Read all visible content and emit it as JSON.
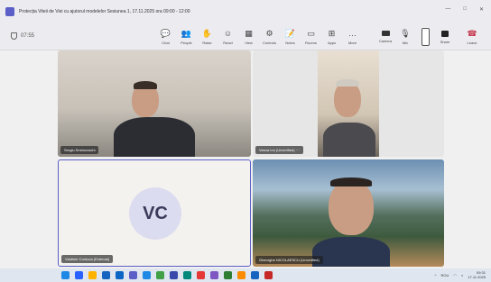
{
  "window": {
    "title": "Protecția Viteii de Viei cu ajutorul modelelor Sesiunea 1, 17.11.2025 ora 09:00 - 12:00",
    "controls": [
      "—",
      "□",
      "✕"
    ]
  },
  "meeting": {
    "timer": "07:55"
  },
  "toolbar": {
    "items": [
      {
        "label": "Chat",
        "icon": "chat-icon",
        "glyph": "💬"
      },
      {
        "label": "People",
        "icon": "people-icon",
        "glyph": "👥"
      },
      {
        "label": "Raise",
        "icon": "raise-hand-icon",
        "glyph": "✋"
      },
      {
        "label": "React",
        "icon": "react-icon",
        "glyph": "☺"
      },
      {
        "label": "View",
        "icon": "view-icon",
        "glyph": "▦"
      },
      {
        "label": "Controls",
        "icon": "controls-icon",
        "glyph": "⚙"
      },
      {
        "label": "Notes",
        "icon": "notes-icon",
        "glyph": "📝"
      },
      {
        "label": "Rooms",
        "icon": "rooms-icon",
        "glyph": "▭"
      },
      {
        "label": "Apps",
        "icon": "apps-icon",
        "glyph": "⊞"
      },
      {
        "label": "More",
        "icon": "more-icon",
        "glyph": "…"
      }
    ],
    "camera_label": "Camera",
    "mic_label": "Mic",
    "share_label": "Share",
    "leave_label": "Leave"
  },
  "participants": [
    {
      "name": "Sergiu Smirnovschi"
    },
    {
      "name": "Vesna Ion (Unverified) ⋯"
    },
    {
      "name": "Vladimir Cordoca (External)",
      "initials": "VC"
    },
    {
      "name": "Gheorghe NICOLAESCU (Unverified)"
    }
  ],
  "taskbar": {
    "lang": "ROU",
    "time": "09:31",
    "date": "17.11.2025",
    "apps": [
      "#1e88e5",
      "#2962ff",
      "#ffb300",
      "#1565c0",
      "#0a66c2",
      "#5b5fc7",
      "#1e88e5",
      "#43a047",
      "#3949ab",
      "#00897b",
      "#e53935",
      "#7e57c2",
      "#2e7d32",
      "#fb8c00",
      "#1565c0",
      "#c62828"
    ]
  },
  "colors": {
    "accent": "#5b5fc7",
    "leave": "#c4314b"
  }
}
